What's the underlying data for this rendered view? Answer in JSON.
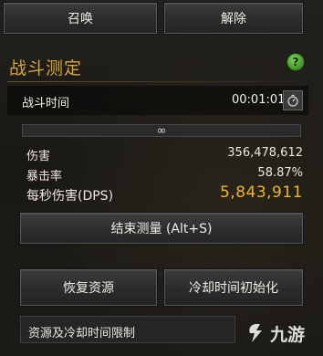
{
  "top_buttons": {
    "summon": "召唤",
    "dismiss": "解除"
  },
  "section": {
    "title": "战斗测定",
    "help_icon": "?"
  },
  "timer": {
    "label": "战斗时间",
    "value": "00:01:01"
  },
  "infinity_bar": {
    "text": "∞"
  },
  "stats": {
    "damage_label": "伤害",
    "damage_value": "356,478,612",
    "crit_label": "暴击率",
    "crit_value": "58.87%",
    "dps_label": "每秒伤害(DPS)",
    "dps_value": "5,843,911"
  },
  "actions": {
    "end_measure": "结束测量 (Alt+S)",
    "restore_resources": "恢复资源",
    "cooldown_reset": "冷却时间初始化",
    "limit_label": "资源及冷却时间限制"
  },
  "watermark": {
    "text": "九游"
  },
  "colors": {
    "accent_title": "#d8a53a",
    "dps_gold": "#f0b52a",
    "help_green": "#5bb13a"
  }
}
